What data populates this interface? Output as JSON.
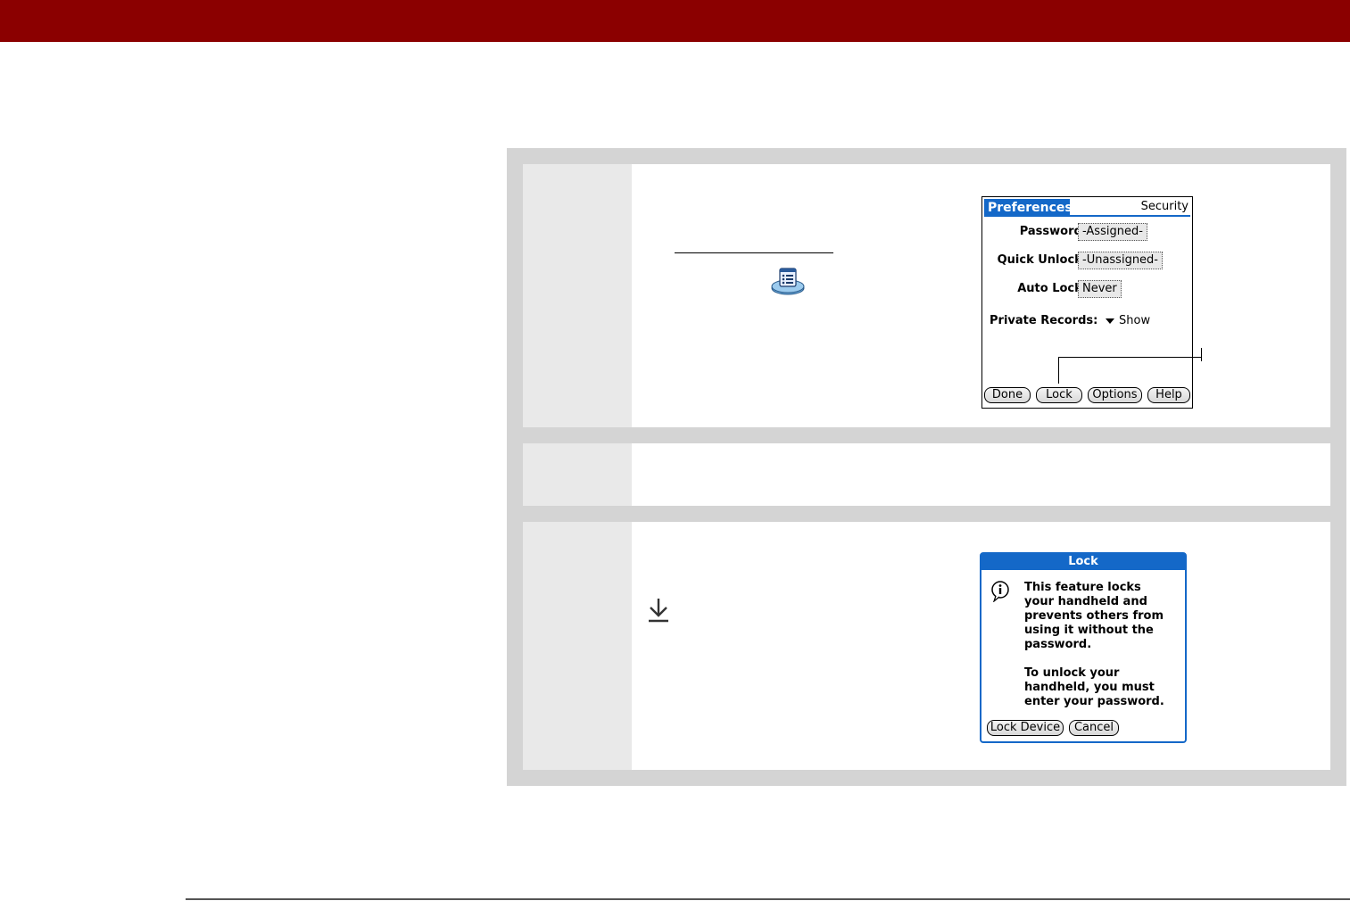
{
  "colors": {
    "header_bar": "#8b0000",
    "palm_accent": "#1468c8"
  },
  "icons": {
    "prefs_app": "preferences-app-icon",
    "tip": "download-arrow-icon",
    "info": "info-icon"
  },
  "security_screen": {
    "title": "Preferences",
    "panel": "Security",
    "password_label": "Password:",
    "password_value": "-Assigned-",
    "quick_unlock_label": "Quick Unlock:",
    "quick_unlock_value": "-Unassigned-",
    "auto_lock_label": "Auto Lock:",
    "auto_lock_value": "Never",
    "private_records_label": "Private Records:",
    "private_records_value": "Show",
    "buttons": {
      "done": "Done",
      "lock": "Lock",
      "options": "Options",
      "help": "Help"
    }
  },
  "lock_dialog": {
    "title": "Lock",
    "message_lines": [
      "This feature locks",
      "your handheld and",
      "prevents others from",
      "using it without the",
      "password."
    ],
    "unlock_lines": [
      "To unlock your",
      "handheld, you must",
      "enter your password."
    ],
    "buttons": {
      "lock_device": "Lock Device",
      "cancel": "Cancel"
    }
  }
}
